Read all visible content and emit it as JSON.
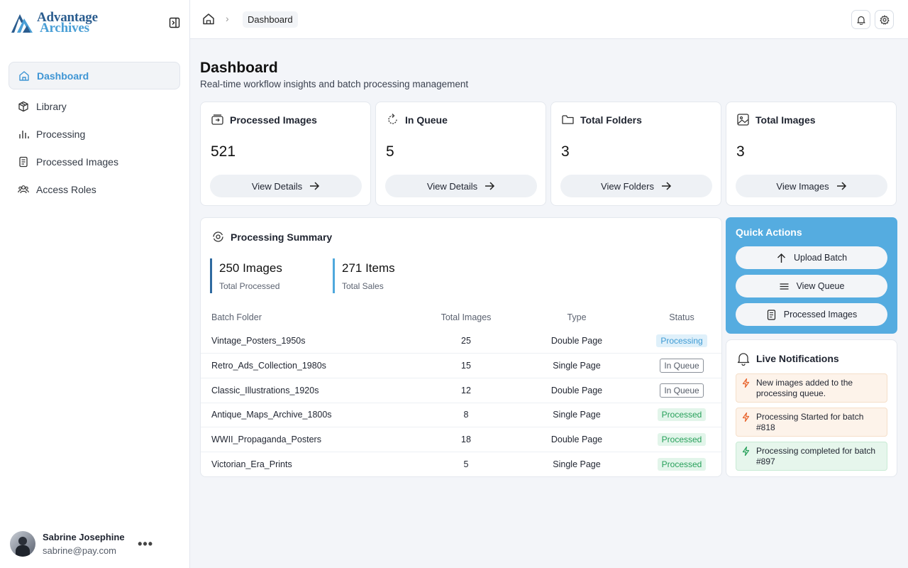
{
  "brand": {
    "line1": "Advantage",
    "line2": "Archives"
  },
  "sidebar": {
    "items": [
      {
        "label": "Dashboard",
        "icon": "home-icon",
        "active": true
      },
      {
        "label": "Library",
        "icon": "cube-icon"
      },
      {
        "label": "Processing",
        "icon": "bar-chart-icon"
      },
      {
        "label": "Processed Images",
        "icon": "document-icon"
      },
      {
        "label": "Access Roles",
        "icon": "users-icon"
      }
    ]
  },
  "user": {
    "name": "Sabrine Josephine",
    "email": "sabrine@pay.com",
    "more": "•••"
  },
  "topbar": {
    "breadcrumb": "Dashboard"
  },
  "page": {
    "title": "Dashboard",
    "subtitle": "Real-time workflow insights and batch processing management"
  },
  "stats": [
    {
      "label": "Processed Images",
      "value": "521",
      "button": "View Details",
      "icon": "image-stack-icon"
    },
    {
      "label": "In Queue",
      "value": "5",
      "button": "View Details",
      "icon": "refresh-icon"
    },
    {
      "label": "Total Folders",
      "value": "3",
      "button": "View Folders",
      "icon": "folder-icon"
    },
    {
      "label": "Total Images",
      "value": "3",
      "button": "View Images",
      "icon": "image-icon"
    }
  ],
  "summary": {
    "title": "Processing Summary",
    "metrics": [
      {
        "value": "250 Images",
        "label": "Total Processed"
      },
      {
        "value": "271 Items",
        "label": "Total Sales"
      }
    ],
    "columns": [
      "Batch Folder",
      "Total Images",
      "Type",
      "Status"
    ],
    "rows": [
      {
        "folder": "Vintage_Posters_1950s",
        "total": "25",
        "type": "Double Page",
        "status": "Processing"
      },
      {
        "folder": "Retro_Ads_Collection_1980s",
        "total": "15",
        "type": "Single Page",
        "status": "In Queue"
      },
      {
        "folder": "Classic_Illustrations_1920s",
        "total": "12",
        "type": "Double Page",
        "status": "In Queue"
      },
      {
        "folder": "Antique_Maps_Archive_1800s",
        "total": "8",
        "type": "Single Page",
        "status": "Processed"
      },
      {
        "folder": "WWII_Propaganda_Posters",
        "total": "18",
        "type": "Double Page",
        "status": "Processed"
      },
      {
        "folder": "Victorian_Era_Prints",
        "total": "5",
        "type": "Single Page",
        "status": "Processed"
      }
    ]
  },
  "quick_actions": {
    "title": "Quick Actions",
    "buttons": [
      "Upload Batch",
      "View Queue",
      "Processed Images"
    ]
  },
  "notifications": {
    "title": "Live Notifications",
    "items": [
      {
        "text": "New images added to the processing queue.",
        "kind": "warn"
      },
      {
        "text": "Processing  Started for batch #818",
        "kind": "warn"
      },
      {
        "text": "Processing completed for batch #897",
        "kind": "ok"
      }
    ]
  },
  "colors": {
    "accent": "#3e95d4",
    "quick_actions_bg": "#55ace0",
    "processed": "#27a05a",
    "warn": "#e8622a"
  }
}
